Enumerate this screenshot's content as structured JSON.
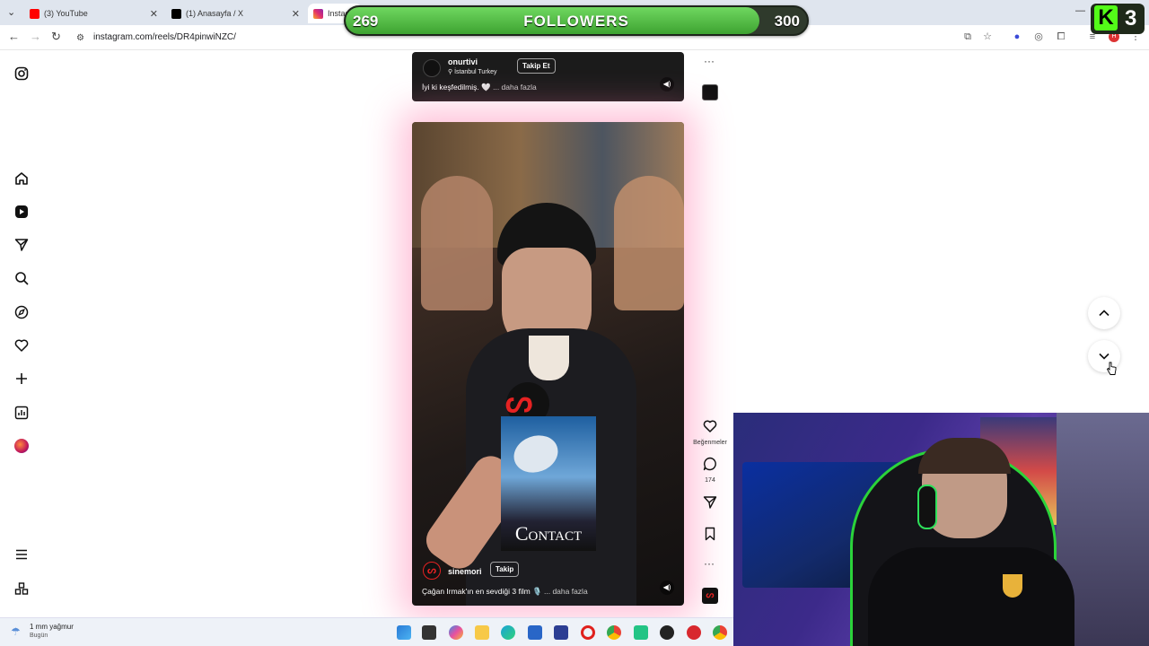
{
  "browser": {
    "tabs": [
      {
        "label": "(3) YouTube",
        "color": "#ff0000"
      },
      {
        "label": "(1) Anasayfa / X",
        "color": "#000000"
      },
      {
        "label": "Instag",
        "color": "#e1306c"
      }
    ],
    "url": "instagram.com/reels/DR4pinwiNZC/"
  },
  "followers_overlay": {
    "current": "269",
    "label": "FOLLOWERS",
    "goal": "300",
    "progress": 0.897,
    "badge_letter": "K",
    "badge_number": "3"
  },
  "sidebar": {
    "items": [
      "instagram-logo",
      "home",
      "reels",
      "messages",
      "search",
      "explore",
      "notifications",
      "create",
      "dashboard",
      "profile"
    ],
    "bottom": [
      "more-menu",
      "also-from-meta"
    ]
  },
  "reel_top": {
    "username": "onurtivi",
    "location": "İstanbul Turkey",
    "follow_label": "Takip Et",
    "caption": "İyi ki keşfedilmiş. 🤍",
    "more_label": "... daha fazla"
  },
  "reel_main": {
    "username": "sinemori",
    "follow_label": "Takip",
    "caption": "Çağan Irmak'ın en sevdiği 3 film 🎙️",
    "more_label": "... daha fazla",
    "poster_title": "Contact",
    "logo_text": "ᔕ"
  },
  "actions": {
    "likes_label": "Beğenmeler",
    "comments_count": "174"
  },
  "taskbar": {
    "weather_text": "1 mm yağmur",
    "weather_sub": "Bugün"
  }
}
